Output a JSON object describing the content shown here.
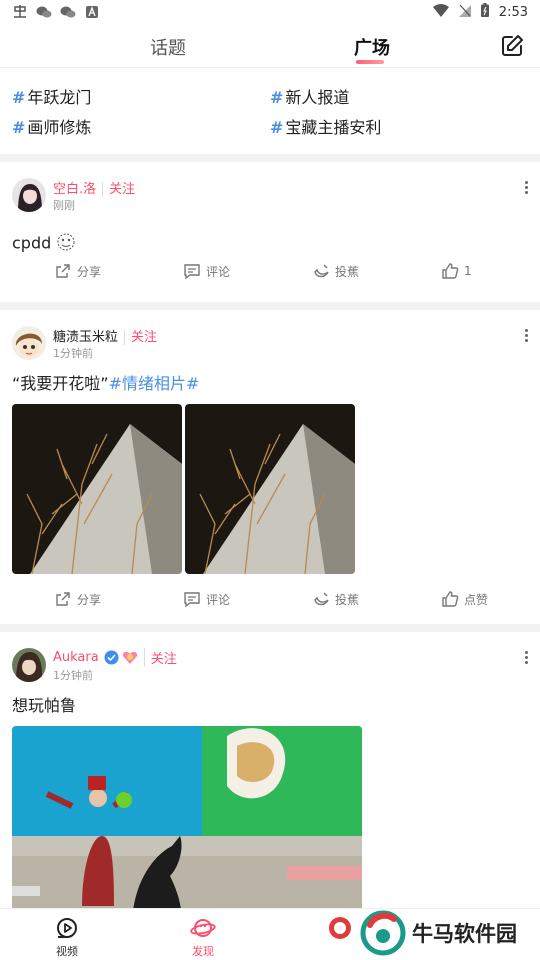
{
  "status": {
    "time": "2:53"
  },
  "header": {
    "tabs": [
      {
        "label": "话题"
      },
      {
        "label": "广场"
      }
    ],
    "edit_icon": "edit-icon"
  },
  "topics": [
    {
      "label": "年跃龙门"
    },
    {
      "label": "新人报道"
    },
    {
      "label": "画师修炼"
    },
    {
      "label": "宝藏主播安利"
    }
  ],
  "posts": [
    {
      "user": "空白.洛",
      "follow": "关注",
      "time": "刚刚",
      "text": "cpdd",
      "actions": {
        "share": "分享",
        "comment": "评论",
        "banana": "投蕉",
        "like": "1"
      }
    },
    {
      "user": "糖渍玉米粒",
      "follow": "关注",
      "time": "1分钟前",
      "text": "“我要开花啦”",
      "tag": "#情绪相片#",
      "actions": {
        "share": "分享",
        "comment": "评论",
        "banana": "投蕉",
        "like": "点赞"
      }
    },
    {
      "user": "Aukara",
      "follow": "关注",
      "time": "1分钟前",
      "text": "想玩帕鲁"
    }
  ],
  "bottom_nav": [
    {
      "label": "视频"
    },
    {
      "label": "发现"
    }
  ],
  "watermark": {
    "text": "牛马软件园"
  },
  "colors": {
    "accent": "#ff4d6a",
    "topic": "#4a90e2"
  }
}
